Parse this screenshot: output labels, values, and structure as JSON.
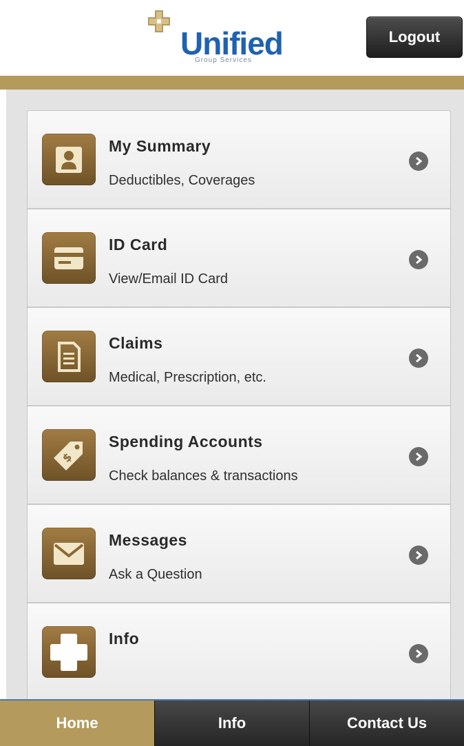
{
  "brand": {
    "name": "Unified",
    "tagline": "Group Services",
    "primary_color": "#1f62b0",
    "accent_color": "#b49a5c"
  },
  "header": {
    "logout_label": "Logout"
  },
  "menu": [
    {
      "title": "My Summary",
      "subtitle": "Deductibles, Coverages",
      "icon": "person-icon"
    },
    {
      "title": "ID Card",
      "subtitle": "View/Email ID Card",
      "icon": "id-card-icon"
    },
    {
      "title": "Claims",
      "subtitle": "Medical, Prescription, etc.",
      "icon": "document-icon"
    },
    {
      "title": "Spending Accounts",
      "subtitle": "Check balances & transactions",
      "icon": "price-tag-icon"
    },
    {
      "title": "Messages",
      "subtitle": "Ask a Question",
      "icon": "envelope-icon"
    },
    {
      "title": "Info",
      "subtitle": "",
      "icon": "cross-icon"
    }
  ],
  "tabs": [
    {
      "label": "Home",
      "active": true
    },
    {
      "label": "Info",
      "active": false
    },
    {
      "label": "Contact Us",
      "active": false
    }
  ]
}
